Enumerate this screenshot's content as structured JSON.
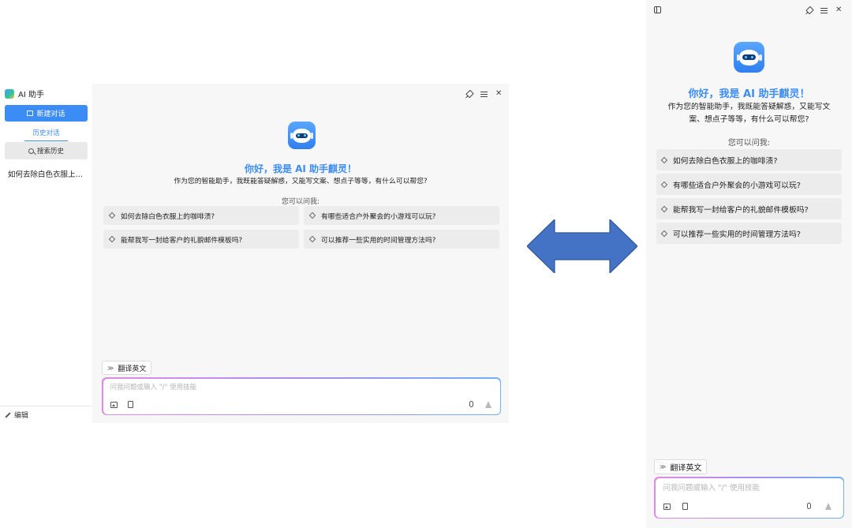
{
  "left_window": {
    "sidebar": {
      "app_title": "AI 助手",
      "new_chat_label": "新建对话",
      "history_tab_label": "历史对话",
      "search_history_label": "搜索历史",
      "history_items": [
        "如何去除白色衣服上…"
      ],
      "edit_label": "编辑"
    },
    "chat": {
      "greeting_title": "你好，我是 AI 助手麒灵！",
      "greeting_subtitle": "作为您的智能助手，我既能答疑解惑，又能写文案、想点子等等，有什么可以帮您?",
      "ask_label": "您可以问我:",
      "suggestions": [
        "如何去除白色衣服上的咖啡渍?",
        "有哪些适合户外聚会的小游戏可以玩?",
        "能帮我写一封给客户的礼貌邮件模板吗?",
        "可以推荐一些实用的时间管理方法吗?"
      ],
      "translate_label": "翻译英文",
      "input_placeholder": "问我问题或输入 \"/\" 使用技能"
    }
  },
  "right_window": {
    "greeting_title": "你好，我是 AI 助手麒灵！",
    "greeting_subtitle_line1": "作为您的智能助手，我既能答疑解惑，又能写文",
    "greeting_subtitle_line2": "案、想点子等等，有什么可以帮您?",
    "ask_label": "您可以问我:",
    "suggestions": [
      "如何去除白色衣服上的咖啡渍?",
      "有哪些适合户外聚会的小游戏可以玩?",
      "能帮我写一封给客户的礼貌邮件模板吗?",
      "可以推荐一些实用的时间管理方法吗?"
    ],
    "translate_label": "翻译英文",
    "input_placeholder": "问我问题或输入 \"/\" 使用技能"
  },
  "colors": {
    "accent": "#3b8cf4",
    "arrow": "#4472c4",
    "arrow_border": "#2f5597"
  }
}
